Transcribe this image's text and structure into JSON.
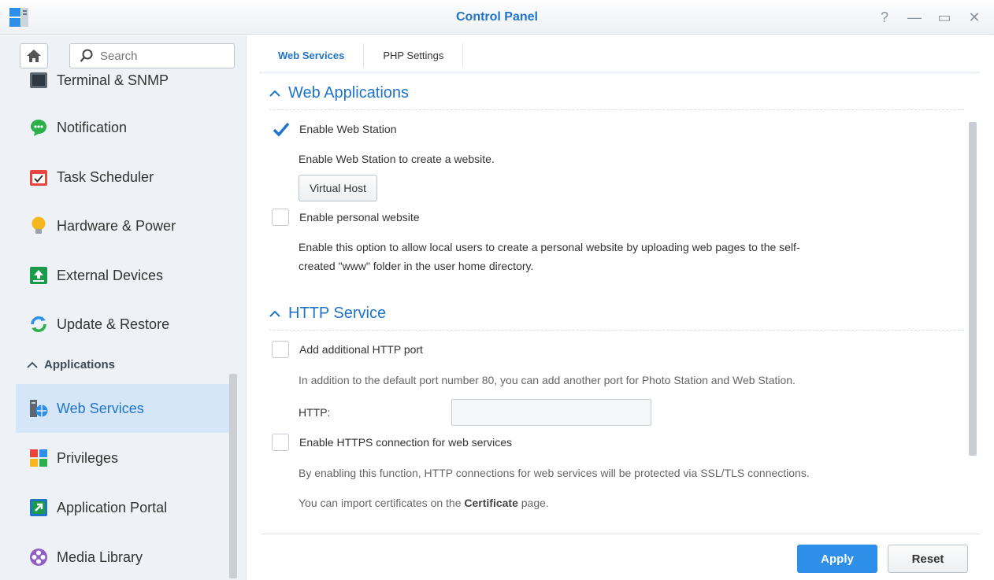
{
  "window": {
    "title": "Control Panel",
    "icon": "control-panel-icon",
    "controls": [
      "help-icon",
      "minimize-icon",
      "maximize-icon",
      "close-icon"
    ]
  },
  "sidebar": {
    "search_placeholder": "Search",
    "items": [
      {
        "label": "Terminal & SNMP",
        "icon": "terminal-icon"
      },
      {
        "label": "Notification",
        "icon": "notification-icon"
      },
      {
        "label": "Task Scheduler",
        "icon": "task-scheduler-icon"
      },
      {
        "label": "Hardware & Power",
        "icon": "lightbulb-icon"
      },
      {
        "label": "External Devices",
        "icon": "external-devices-icon"
      },
      {
        "label": "Update & Restore",
        "icon": "update-icon"
      }
    ],
    "section_label": "Applications",
    "app_items": [
      {
        "label": "Web Services",
        "icon": "web-services-icon",
        "active": true
      },
      {
        "label": "Privileges",
        "icon": "privileges-icon"
      },
      {
        "label": "Application Portal",
        "icon": "application-portal-icon"
      },
      {
        "label": "Media Library",
        "icon": "media-library-icon"
      }
    ]
  },
  "tabs": [
    "Web Services",
    "PHP Settings"
  ],
  "web_apps": {
    "heading": "Web Applications",
    "enable_web_station": {
      "label": "Enable Web Station",
      "checked": true
    },
    "web_station_desc": "Enable Web Station to create a website.",
    "virtual_host_button": "Virtual Host",
    "enable_personal": {
      "label": "Enable personal website",
      "checked": false
    },
    "personal_desc_1": "Enable this option to allow local users to create a personal website by uploading web pages to the self-",
    "personal_desc_2": "created \"www\" folder in the user home directory."
  },
  "http_service": {
    "heading": "HTTP Service",
    "add_port": {
      "label": "Add additional HTTP port",
      "checked": false
    },
    "add_port_desc": "In addition to the default port number 80, you can add another port for Photo Station and Web Station.",
    "http_label": "HTTP:",
    "http_value": "",
    "enable_https": {
      "label": "Enable HTTPS connection for web services",
      "checked": false
    },
    "https_desc": "By enabling this function, HTTP connections for web services will be protected via SSL/TLS connections.",
    "cert_prefix": "You can import certificates on the ",
    "cert_link": "Certificate",
    "cert_suffix": " page."
  },
  "footer": {
    "apply": "Apply",
    "reset": "Reset"
  },
  "colors": {
    "accent": "#1f74c9",
    "apply_bg": "#2d8fe8",
    "active_item_bg": "#d4e6f8"
  }
}
